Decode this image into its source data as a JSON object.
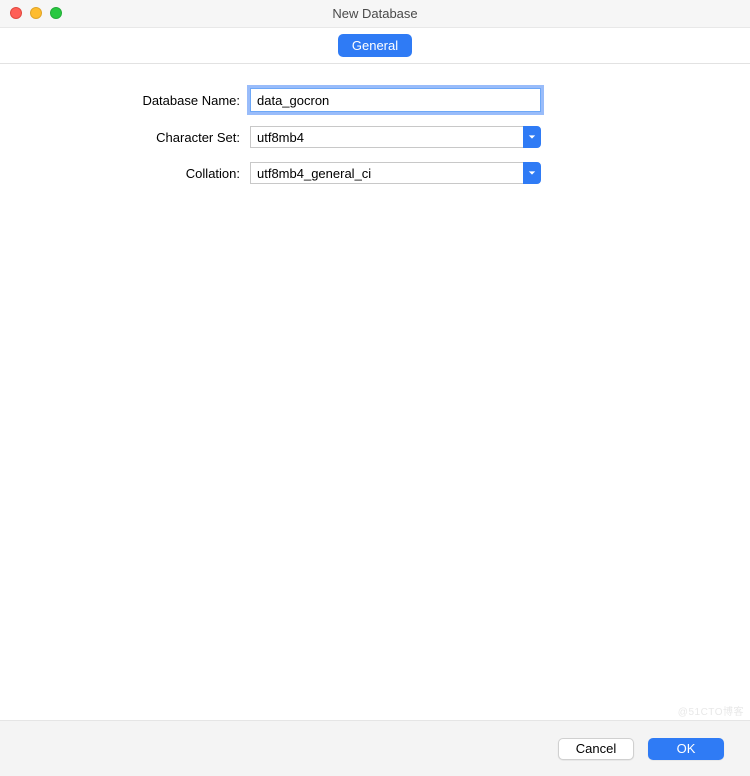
{
  "window": {
    "title": "New Database"
  },
  "tabs": {
    "general": "General"
  },
  "form": {
    "database_name": {
      "label": "Database Name:",
      "value": "data_gocron"
    },
    "character_set": {
      "label": "Character Set:",
      "value": "utf8mb4"
    },
    "collation": {
      "label": "Collation:",
      "value": "utf8mb4_general_ci"
    }
  },
  "footer": {
    "cancel": "Cancel",
    "ok": "OK"
  },
  "watermark": "@51CTO博客"
}
